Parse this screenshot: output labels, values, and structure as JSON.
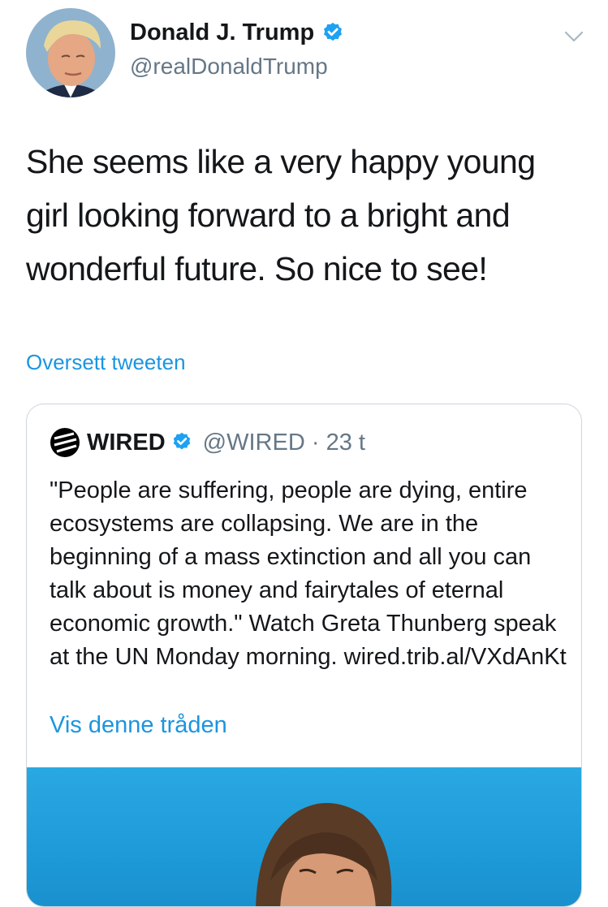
{
  "tweet": {
    "author_name": "Donald J. Trump",
    "author_handle": "@realDonaldTrump",
    "text": "She seems like a very happy young girl looking forward to a bright and wonderful future. So nice to see!",
    "translate_link": "Oversett tweeten"
  },
  "quoted_tweet": {
    "author_name": "WIRED",
    "author_handle": "@WIRED",
    "separator": " · ",
    "age": "23 t",
    "text": "\"People are suffering, people are dying, entire ecosystems are collapsing. We are in the beginning of a mass extinction and all you can talk about is money and fairytales of eternal economic growth.\" Watch Greta Thunberg speak at the UN Monday morning. wired.trib.al/VXdAnKt",
    "show_thread": "Vis denne tråden"
  },
  "colors": {
    "link": "#1b95e0",
    "verified": "#1da1f2",
    "secondary_text": "#657786",
    "media_background": "#1d9ad8"
  },
  "icons": {
    "verified": "verified-badge-icon",
    "more": "chevron-down-icon",
    "wired_logo": "wired-logo-icon"
  }
}
